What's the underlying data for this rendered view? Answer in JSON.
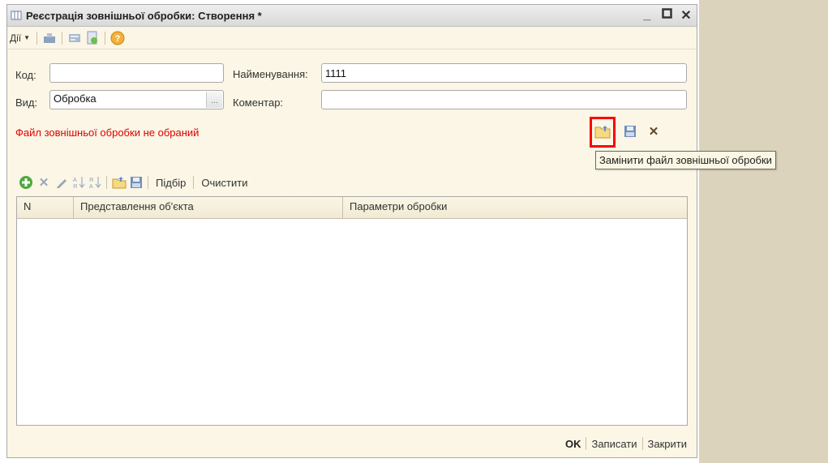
{
  "window": {
    "title": "Реєстрація зовнішньої обробки: Створення *"
  },
  "toolbar": {
    "actions_label": "Дії"
  },
  "form": {
    "code_label": "Код:",
    "code_value": "",
    "name_label": "Найменування:",
    "name_value": "1111",
    "kind_label": "Вид:",
    "kind_value": "Обробка",
    "comment_label": "Коментар:",
    "comment_value": ""
  },
  "file_status": "Файл зовнішньої обробки не обраний",
  "tooltip": "Замінити файл зовнішньої обробки",
  "table_toolbar": {
    "pick_label": "Підбір",
    "clear_label": "Очистити"
  },
  "table": {
    "columns": [
      "N",
      "Представлення об'єкта",
      "Параметри обробки"
    ],
    "rows": []
  },
  "footer": {
    "ok_label": "OK",
    "save_label": "Записати",
    "close_label": "Закрити"
  },
  "colors": {
    "form_bg": "#fbf6e5",
    "status_red": "#e00000",
    "highlight": "#ff0000",
    "desktop_bg": "#dcd3bd"
  }
}
